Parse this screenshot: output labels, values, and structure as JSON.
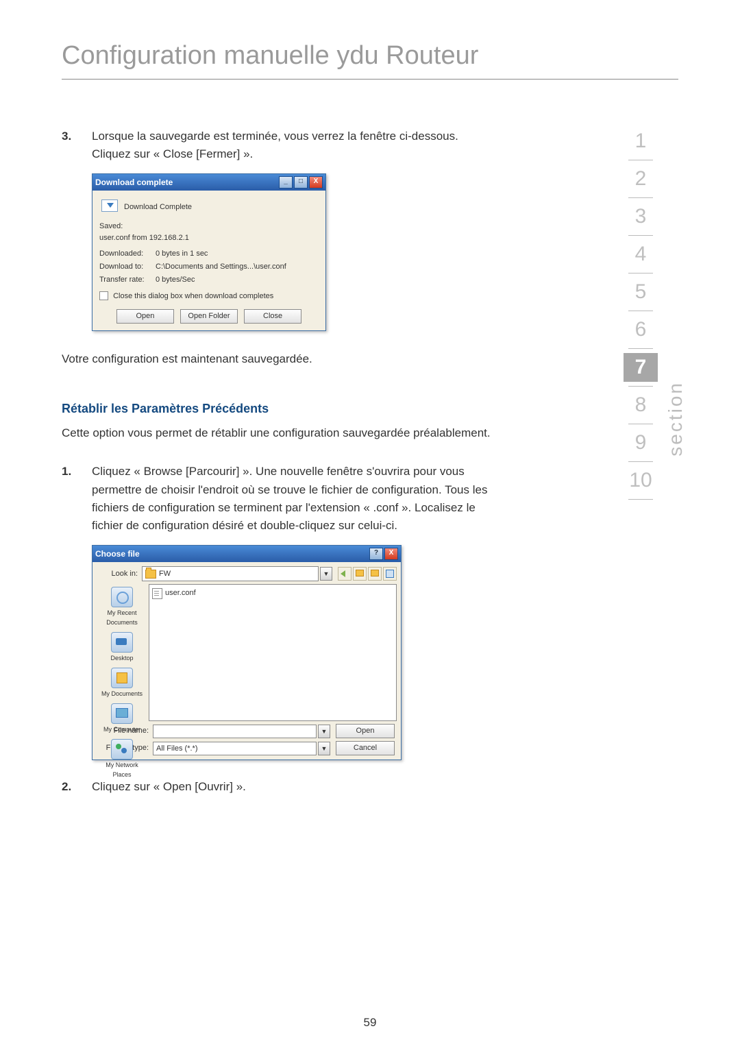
{
  "page": {
    "title": "Configuration manuelle ydu Routeur",
    "footer": "59"
  },
  "sidenav": {
    "label": "section",
    "items": [
      "1",
      "2",
      "3",
      "4",
      "5",
      "6",
      "7",
      "8",
      "9",
      "10"
    ],
    "active_index": 6
  },
  "p3": {
    "num": "3.",
    "text": "Lorsque la sauvegarde est terminée, vous verrez la fenêtre ci-dessous. Cliquez sur « Close [Fermer] »."
  },
  "dlg1": {
    "title": "Download complete",
    "heading": "Download Complete",
    "saved_label": "Saved:",
    "saved_value": "user.conf from 192.168.2.1",
    "rows": {
      "downloaded_label": "Downloaded:",
      "downloaded_value": "0 bytes in 1 sec",
      "downloadto_label": "Download to:",
      "downloadto_value": "C:\\Documents and Settings...\\user.conf",
      "rate_label": "Transfer rate:",
      "rate_value": "0 bytes/Sec"
    },
    "checkbox": "Close this dialog box when download completes",
    "buttons": {
      "open": "Open",
      "openfolder": "Open Folder",
      "close": "Close"
    }
  },
  "p_after_dlg1": "Votre configuration est maintenant sauvegardée.",
  "sub1": "Rétablir les Paramètres Précédents",
  "sub1_text": "Cette option vous permet de rétablir une configuration sauvegardée préalablement.",
  "p1": {
    "num": "1.",
    "text": "Cliquez « Browse [Parcourir] ». Une nouvelle fenêtre s'ouvrira pour vous permettre de choisir l'endroit où se trouve le fichier de configuration. Tous les fichiers de configuration se terminent par l'extension « .conf ». Localisez le fichier de configuration désiré et double-cliquez sur celui-ci."
  },
  "dlg2": {
    "title": "Choose file",
    "lookin_label": "Look in:",
    "lookin_value": "FW",
    "places": {
      "recent": "My Recent Documents",
      "desktop": "Desktop",
      "docs": "My Documents",
      "computer": "My Computer",
      "network": "My Network Places"
    },
    "file_item": "user.conf",
    "filename_label": "File name:",
    "filename_value": "",
    "filetype_label": "Files of type:",
    "filetype_value": "All Files (*.*)",
    "buttons": {
      "open": "Open",
      "cancel": "Cancel"
    }
  },
  "p2": {
    "num": "2.",
    "text": "Cliquez sur « Open [Ouvrir] »."
  }
}
